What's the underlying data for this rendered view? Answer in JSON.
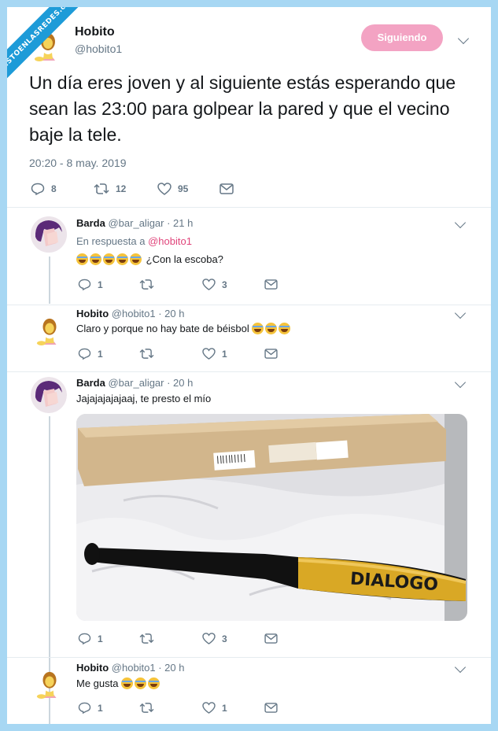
{
  "watermark": "VISTOENLASREDES.com",
  "main_tweet": {
    "name": "Hobito",
    "handle": "@hobito1",
    "follow_label": "Siguiendo",
    "text": "Un día eres joven y al siguiente estás esperando que sean las 23:00 para golpear la pared y que el vecino baje la tele.",
    "timestamp": "20:20 - 8 may. 2019",
    "replies": "8",
    "retweets": "12",
    "likes": "95"
  },
  "replies": [
    {
      "name": "Barda",
      "meta": "@bar_aligar · 21 h",
      "reply_to_prefix": "En respuesta a",
      "reply_to_handle": "@hobito1",
      "text": "¿Con la escoba?",
      "emoji_count": 5,
      "replies": "1",
      "likes": "3"
    },
    {
      "name": "Hobito",
      "meta": "@hobito1 · 20 h",
      "text": "Claro y porque no hay bate de béisbol",
      "emoji_count": 3,
      "replies": "1",
      "likes": "1"
    },
    {
      "name": "Barda",
      "meta": "@bar_aligar · 20 h",
      "text": "Jajajajajajaaj, te presto el mío",
      "image_text": "DIALOGO",
      "replies": "1",
      "likes": "3"
    },
    {
      "name": "Hobito",
      "meta": "@hobito1 · 20 h",
      "text": "Me gusta",
      "emoji_count": 3,
      "replies": "1",
      "likes": "1"
    }
  ],
  "colors": {
    "background": "#a7d7f3",
    "follow_button": "#f3a3c3",
    "mention": "#e0457b",
    "muted": "#657786"
  },
  "icons": [
    "reply-icon",
    "retweet-icon",
    "like-icon",
    "message-icon",
    "chevron-down-icon"
  ]
}
